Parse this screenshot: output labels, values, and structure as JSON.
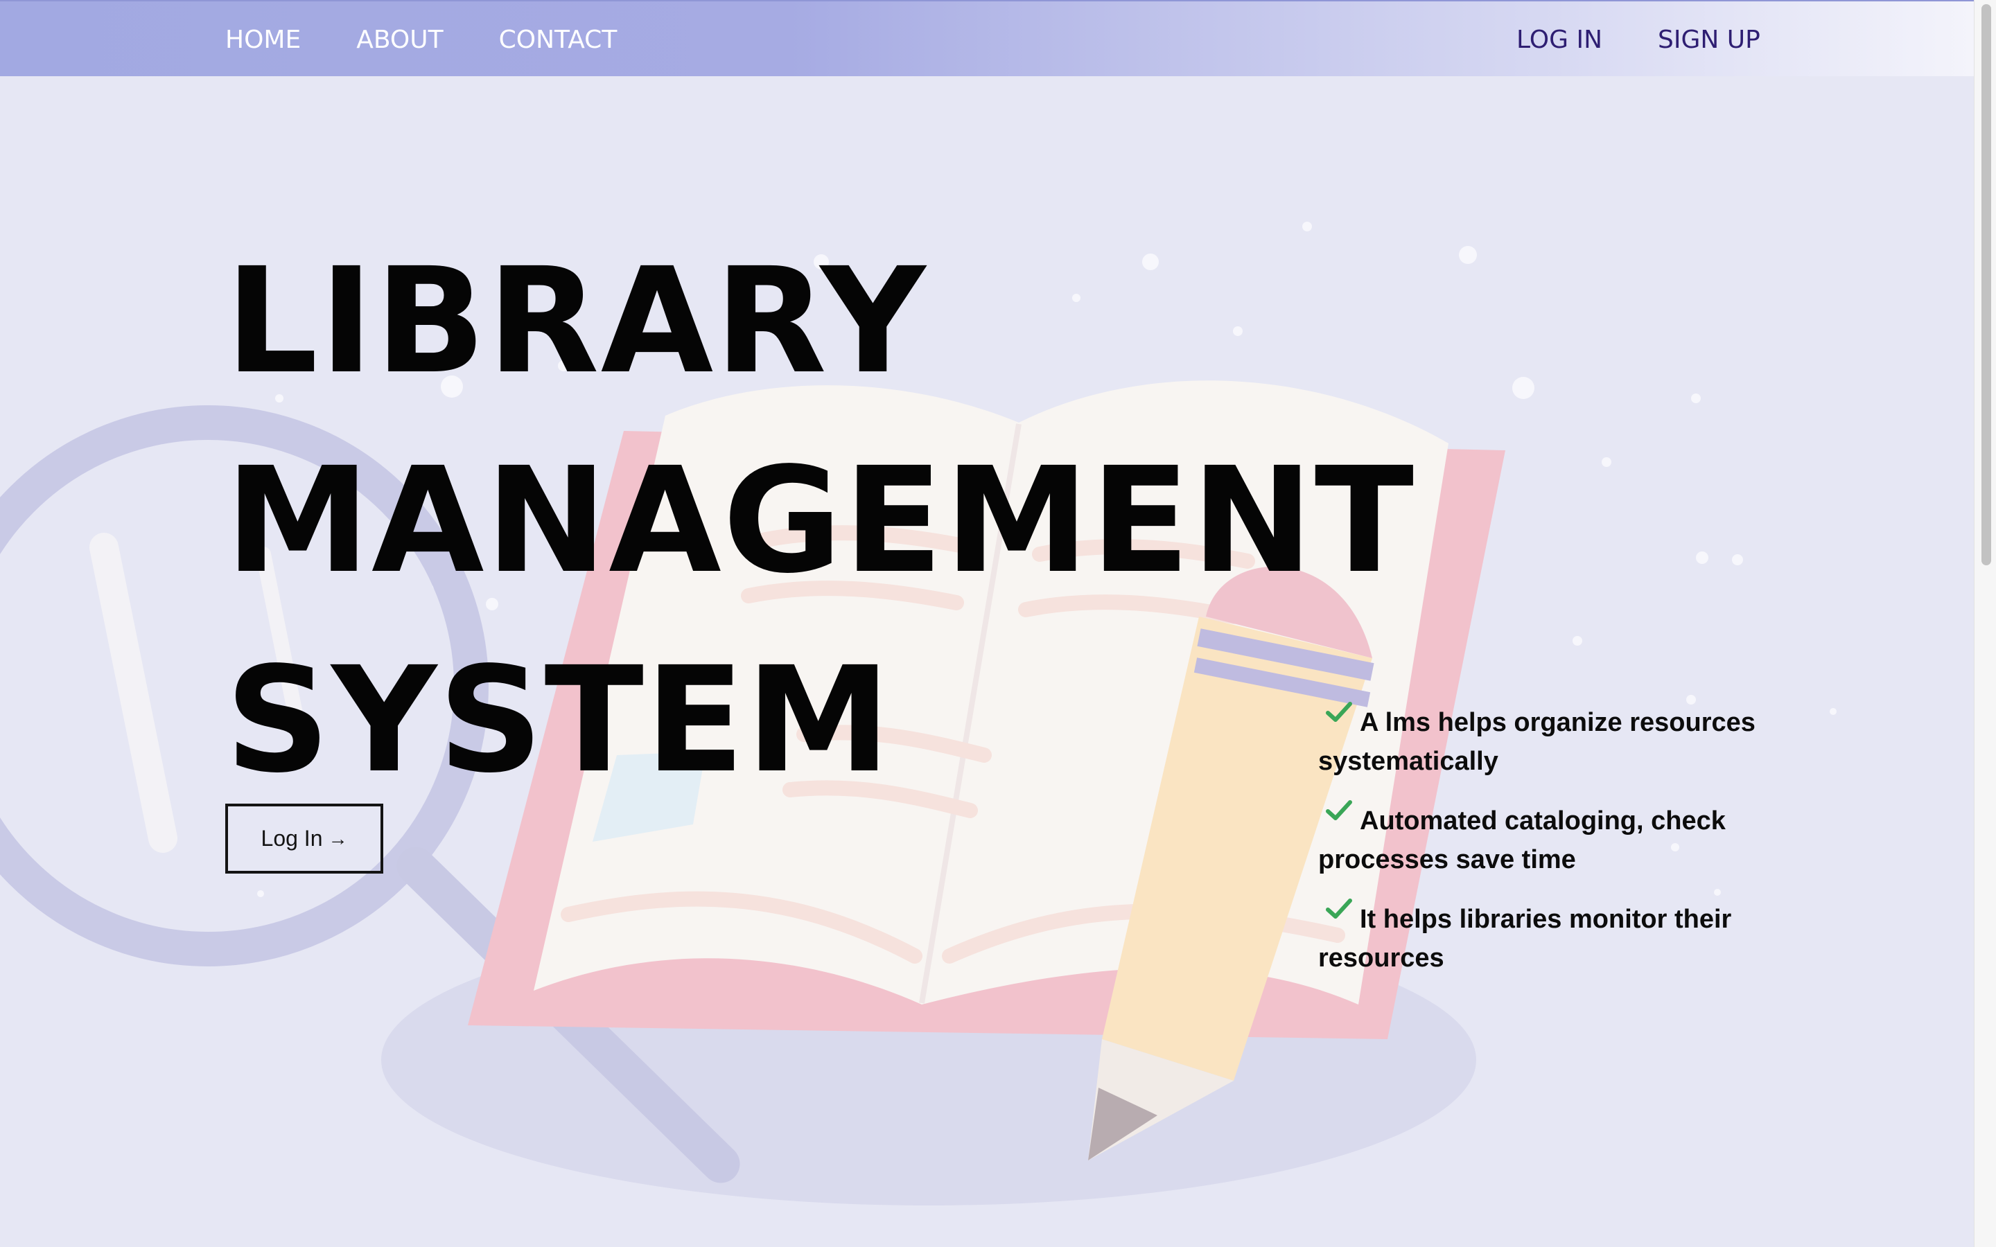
{
  "nav": {
    "left": [
      {
        "label": "HOME"
      },
      {
        "label": "ABOUT"
      },
      {
        "label": "CONTACT"
      }
    ],
    "right": [
      {
        "label": "LOG IN"
      },
      {
        "label": "SIGN UP"
      }
    ]
  },
  "hero": {
    "title_lines": [
      "LIBRARY",
      "MANAGEMENT",
      "SYSTEM"
    ],
    "button_label": "Log In",
    "button_arrow": "→"
  },
  "features": [
    {
      "text": "A lms helps organize resources systematically"
    },
    {
      "text": "Automated cataloging, check processes save time"
    },
    {
      "text": "It helps libraries monitor their resources"
    }
  ],
  "colors": {
    "nav_link": "#ffffff",
    "nav_auth_link": "#2e1e72",
    "check": "#3aa657",
    "background": "#e6e7f4"
  }
}
